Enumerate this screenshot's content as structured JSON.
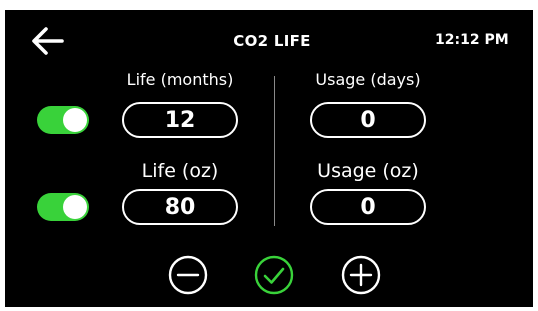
{
  "header": {
    "title": "CO2 LIFE",
    "time": "12:12 PM",
    "back_icon": "arrow-left-icon"
  },
  "left": {
    "life_months": {
      "label": "Life (months)",
      "value": "12",
      "toggle_on": true
    },
    "life_oz": {
      "label": "Life (oz)",
      "value": "80",
      "toggle_on": true
    }
  },
  "right": {
    "usage_days": {
      "label": "Usage (days)",
      "value": "0"
    },
    "usage_oz": {
      "label": "Usage (oz)",
      "value": "0"
    }
  },
  "controls": {
    "decrease_icon": "minus-circle-icon",
    "confirm_icon": "check-circle-icon",
    "increase_icon": "plus-circle-icon"
  },
  "colors": {
    "background": "#000000",
    "text": "#ffffff",
    "accent_green": "#39d23a",
    "divider": "#8a8a8a"
  }
}
